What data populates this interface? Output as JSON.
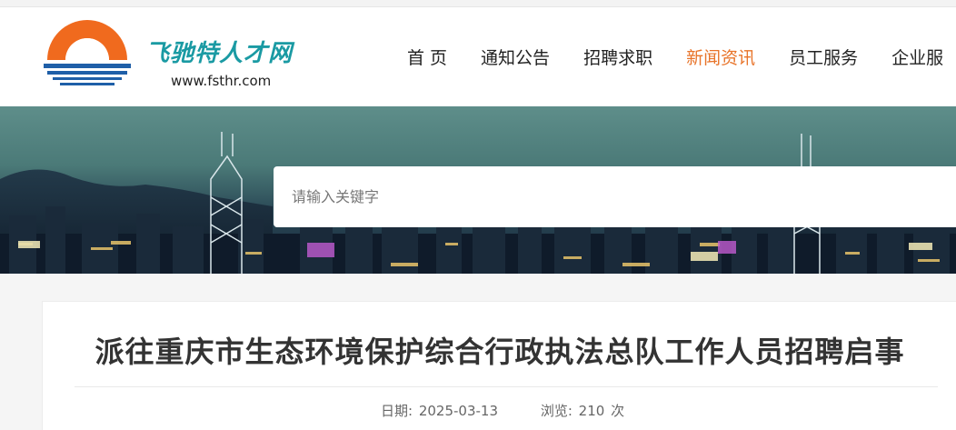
{
  "logo": {
    "title": "飞驰特人才网",
    "url": "www.fsthr.com",
    "colors": {
      "sun": "#f06a1e",
      "water": "#1f5fa8",
      "title": "#1a9aa3"
    }
  },
  "nav": {
    "items": [
      {
        "label": "首 页"
      },
      {
        "label": "通知公告"
      },
      {
        "label": "招聘求职"
      },
      {
        "label": "新闻资讯"
      },
      {
        "label": "员工服务"
      },
      {
        "label": "企业服"
      }
    ],
    "active_index": 3,
    "active_color": "#e8742a"
  },
  "search": {
    "placeholder": "请输入关键字",
    "value": ""
  },
  "article": {
    "title": "派往重庆市生态环境保护综合行政执法总队工作人员招聘启事",
    "date_label": "日期:",
    "date": "2025-03-13",
    "views_label": "浏览:",
    "views": "210",
    "views_unit": "次"
  }
}
